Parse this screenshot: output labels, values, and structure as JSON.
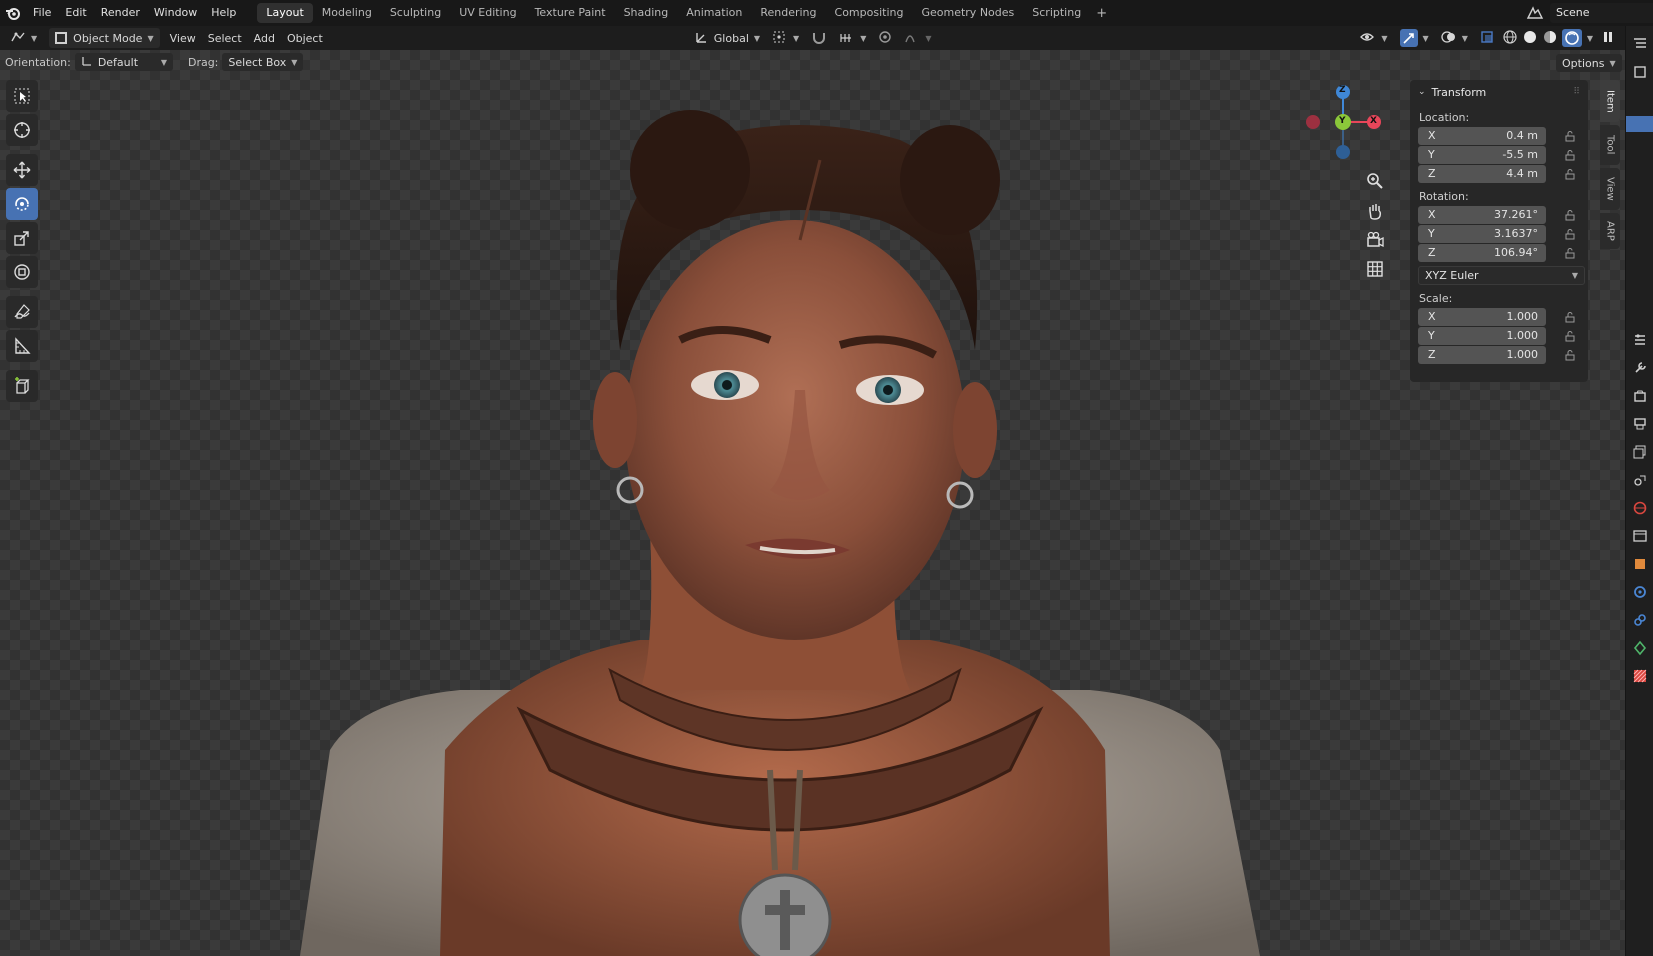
{
  "menu": {
    "items": [
      "File",
      "Edit",
      "Render",
      "Window",
      "Help"
    ]
  },
  "workspaces": {
    "tabs": [
      "Layout",
      "Modeling",
      "Sculpting",
      "UV Editing",
      "Texture Paint",
      "Shading",
      "Animation",
      "Rendering",
      "Compositing",
      "Geometry Nodes",
      "Scripting"
    ],
    "active": "Layout",
    "add_label": "+"
  },
  "scene": {
    "name": "Scene"
  },
  "header": {
    "mode": "Object Mode",
    "view": "View",
    "select": "Select",
    "add": "Add",
    "object": "Object",
    "transform_orientation": "Global"
  },
  "tool_settings": {
    "orientation_label": "Orientation:",
    "orientation_value": "Default",
    "drag_label": "Drag:",
    "drag_value": "Select Box",
    "options": "Options"
  },
  "gizmo": {
    "x": "X",
    "y": "Y",
    "z": "Z"
  },
  "npanel": {
    "title": "Transform",
    "location_label": "Location:",
    "location": [
      {
        "axis": "X",
        "value": "0.4 m"
      },
      {
        "axis": "Y",
        "value": "-5.5 m"
      },
      {
        "axis": "Z",
        "value": "4.4 m"
      }
    ],
    "rotation_label": "Rotation:",
    "rotation": [
      {
        "axis": "X",
        "value": "37.261°"
      },
      {
        "axis": "Y",
        "value": "3.1637°"
      },
      {
        "axis": "Z",
        "value": "106.94°"
      }
    ],
    "rotation_mode": "XYZ Euler",
    "scale_label": "Scale:",
    "scale": [
      {
        "axis": "X",
        "value": "1.000"
      },
      {
        "axis": "Y",
        "value": "1.000"
      },
      {
        "axis": "Z",
        "value": "1.000"
      }
    ]
  },
  "sidebar_tabs": [
    "Item",
    "Tool",
    "View",
    "ARP"
  ],
  "colors": {
    "accent": "#4772b3",
    "axis_x": "#e8465a",
    "axis_y": "#8bc83a",
    "axis_z": "#3f87d6"
  }
}
